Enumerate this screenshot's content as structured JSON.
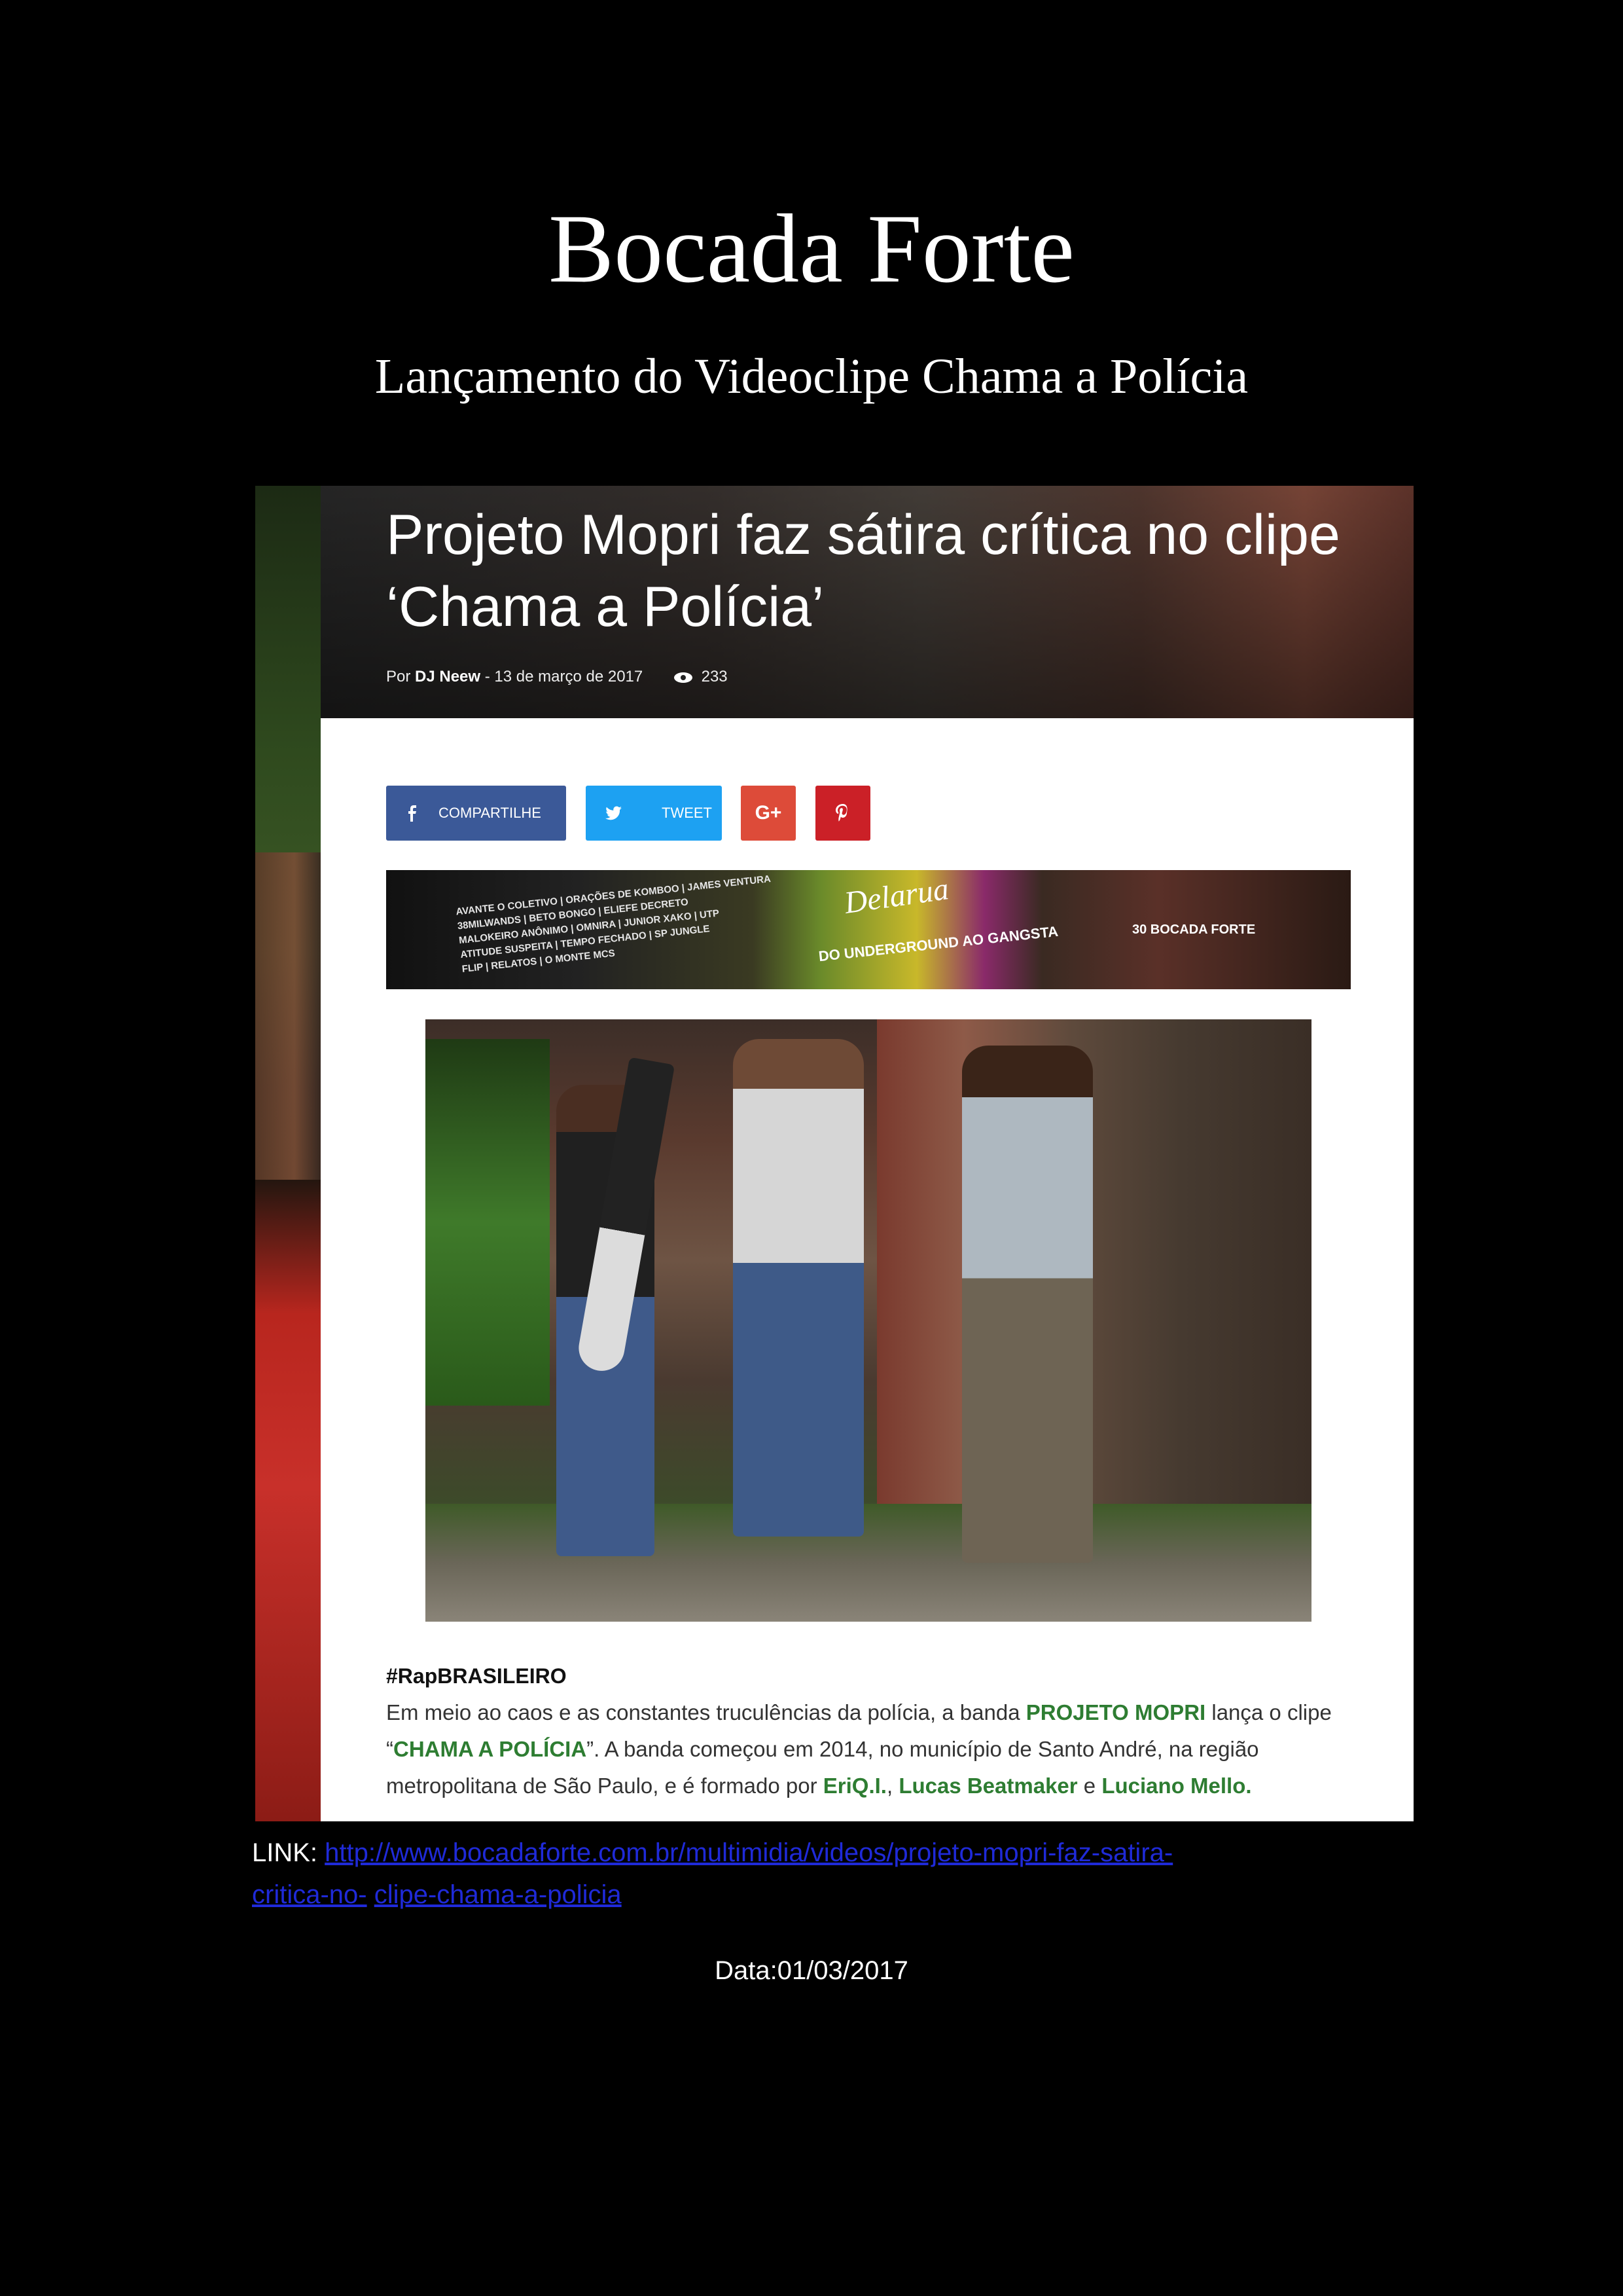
{
  "document": {
    "title": "Bocada Forte",
    "subtitle": "Lançamento do Videoclipe Chama a Polícia"
  },
  "screenshot": {
    "headline_line1": "Projeto Mopri faz sátira crítica no clipe",
    "headline_line2": "‘Chama a Polícia’",
    "meta_by": "Por",
    "meta_author": "DJ Neew",
    "meta_sep": "-",
    "meta_date": "13 de março de 2017",
    "meta_views": "233",
    "share_facebook": "COMPARTILHE",
    "share_twitter": "TWEET",
    "share_gplus": "G+",
    "banner": {
      "lineup": "AVANTE O COLETIVO | ORAÇÕES DE KOMBOO | JAMES VENTURA\n38MILWANDS | BETO BONGO | ELIEFE DECRETO\nMALOKEIRO ANÔNIMO | OMNIRA | JUNIOR XAKO | UTP\nATITUDE SUSPEITA | TEMPO FECHADO | SP JUNGLE\nFLIP | RELATOS | O MONTE MCS",
      "logo": "Delarua",
      "sub": "DO UNDERGROUND AO GANGSTA",
      "right": "30 BOCADA FORTE"
    },
    "article_tag": "#RapBRASILEIRO",
    "article_p1": "Em meio ao caos e as constantes truculências da polícia, a banda ",
    "article_hl1": "PROJETO MOPRI",
    "article_p2": " lança o clipe “",
    "article_hl2": "CHAMA A POLÍCIA",
    "article_p3": "”. A banda começou em 2014, no município de Santo André, na região metropolitana de São Paulo, e é formado por ",
    "article_hl3": "EriQ.I.",
    "article_p4": ", ",
    "article_hl4": "Lucas Beatmaker",
    "article_p5": " e ",
    "article_hl5": "Luciano Mello.",
    "colors": {
      "facebook": "#3b5998",
      "twitter": "#1da1f2",
      "gplus": "#dd4b39",
      "pinterest": "#cb2027",
      "highlight": "#2e7d32"
    },
    "icons": [
      "facebook-icon",
      "twitter-icon",
      "pinterest-icon",
      "eye-icon"
    ]
  },
  "link": {
    "label": "LINK:",
    "url_part1": "http://www.bocadaforte.com.br/multimidia/videos/projeto-mopri-faz-satira-",
    "url_part2": "critica-no-",
    "url_part3": "clipe-chama-a-policia"
  },
  "date": "Data:01/03/2017"
}
